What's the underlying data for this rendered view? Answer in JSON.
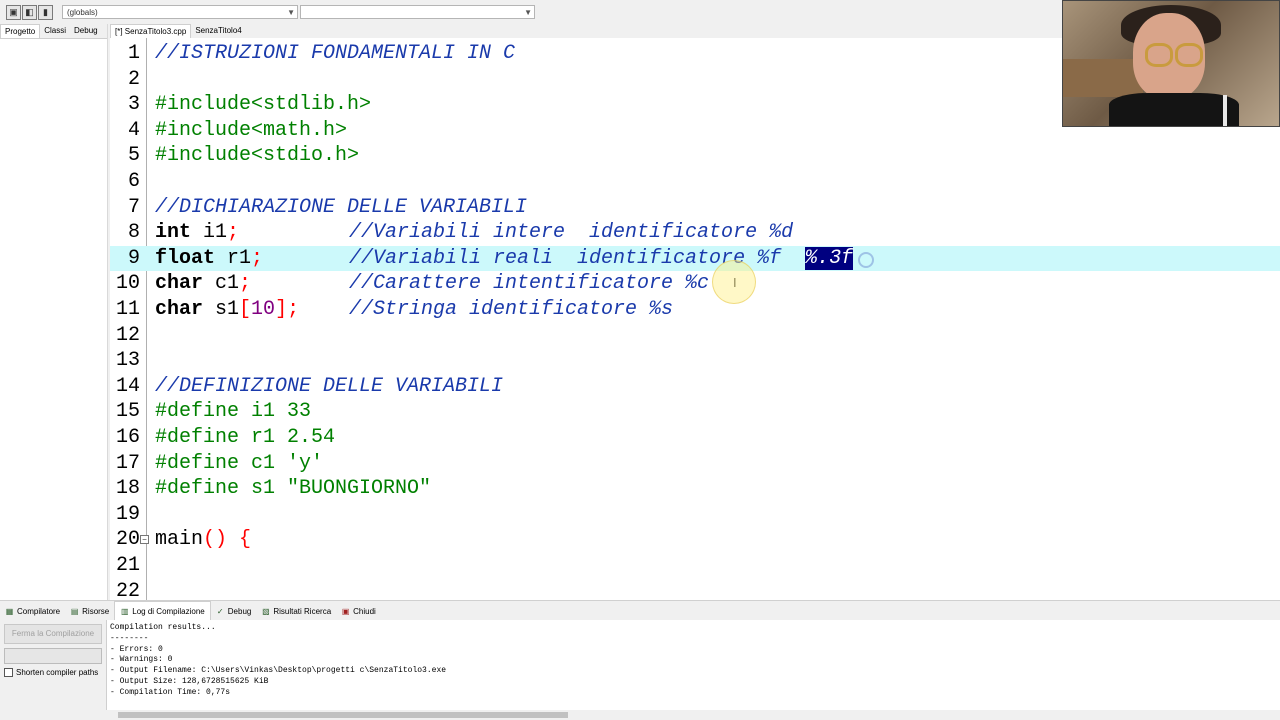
{
  "toolbar": {
    "combo_value": "(globals)"
  },
  "left_panel": {
    "tabs": [
      "Progetto",
      "Classi",
      "Debug"
    ]
  },
  "editor_tabs": [
    "[*] SenzaTitolo3.cpp",
    "SenzaTitolo4"
  ],
  "code": {
    "line_numbers": [
      "1",
      "2",
      "3",
      "4",
      "5",
      "6",
      "7",
      "8",
      "9",
      "10",
      "11",
      "12",
      "13",
      "14",
      "15",
      "16",
      "17",
      "18",
      "19",
      "20",
      "21",
      "22"
    ],
    "l1": "//ISTRUZIONI FONDAMENTALI IN C",
    "l3": "#include<stdlib.h>",
    "l4": "#include<math.h>",
    "l5": "#include<stdio.h>",
    "l7": "//DICHIARAZIONE DELLE VARIABILI",
    "l8_kw": "int",
    "l8_id": " i1",
    "l8_pu": ";",
    "l8_cmt": "//Variabili intere  identificatore %d",
    "l9_kw": "float",
    "l9_id": " r1",
    "l9_pu": ";",
    "l9_cmt": "//Variabili reali  identificatore %f  ",
    "l9_sel": "%.3f",
    "l10_kw": "char",
    "l10_id": " c1",
    "l10_pu": ";",
    "l10_cmt": "//Carattere intentificatore %c",
    "l11_kw": "char",
    "l11_id": " s1",
    "l11_pu1": "[",
    "l11_num": "10",
    "l11_pu2": "];",
    "l11_cmt": "//Stringa identificatore %s",
    "l14": "//DEFINIZIONE DELLE VARIABILI",
    "l15": "#define i1 33",
    "l16": "#define r1 2.54",
    "l17": "#define c1 'y'",
    "l18": "#define s1 \"BUONGIORNO\"",
    "l20_id": "main",
    "l20_pu": "() {"
  },
  "bottom_tabs": [
    "Compilatore",
    "Risorse",
    "Log di Compilazione",
    "Debug",
    "Risultati Ricerca",
    "Chiudi"
  ],
  "bottom_left": {
    "stop_button": "Ferma la Compilazione",
    "checkbox_label": "Shorten compiler paths"
  },
  "log_lines": [
    "Compilation results...",
    "--------",
    "- Errors: 0",
    "- Warnings: 0",
    "- Output Filename: C:\\Users\\Vinkas\\Desktop\\progetti c\\SenzaTitolo3.exe",
    "- Output Size: 128,6728515625 KiB",
    "- Compilation Time: 0,77s"
  ],
  "colors": {
    "comment": "#1a3aab",
    "preprocessor": "#008000",
    "punctuation": "#ff0000",
    "number": "#800080",
    "highlight_line": "#ccf9fb",
    "selection": "#000080"
  }
}
